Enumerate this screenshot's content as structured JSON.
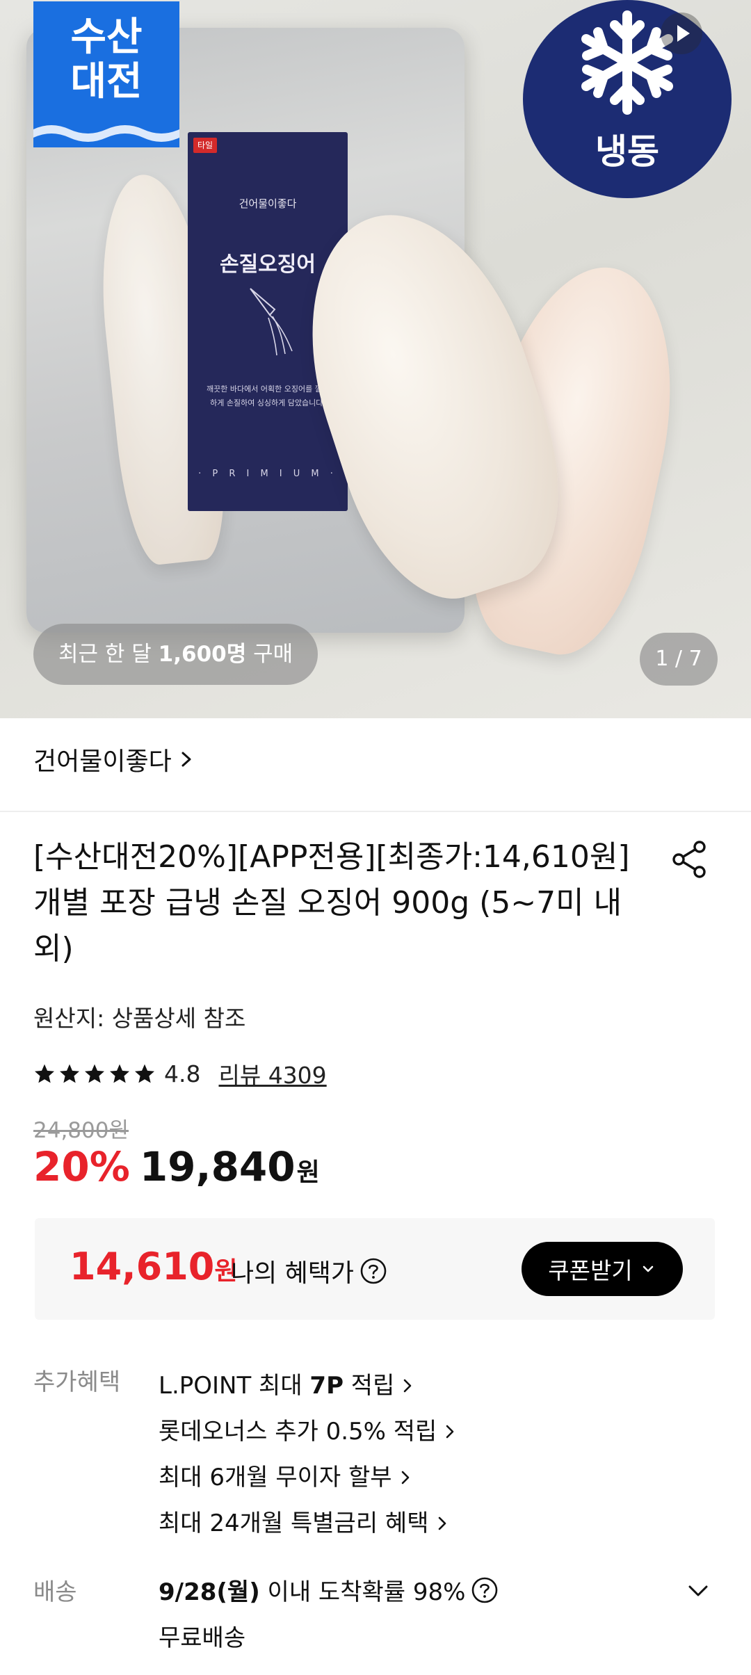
{
  "hero": {
    "sale_badge": {
      "line1": "수산",
      "line2": "대전"
    },
    "frozen_badge": "냉동",
    "package": {
      "tag": "타일",
      "brand": "건어물이좋다",
      "name": "손질오징어",
      "desc": "깨끗한 바다에서 어획한 오징어를 깔끔하게 손질하여 싱싱하게 담았습니다.",
      "premium": "· P R I M I U M ·"
    },
    "buyers_chip": {
      "prefix": "최근 한 달 ",
      "count": "1,600명",
      "suffix": " 구매"
    },
    "page_indicator": "1 / 7"
  },
  "seller": {
    "name": "건어물이좋다"
  },
  "product": {
    "title": "[수산대전20%][APP전용][최종가:14,610원]개별 포장 급냉 손질 오징어 900g (5~7미 내외)",
    "origin": "원산지: 상품상세 참조",
    "rating": {
      "score": "4.8",
      "review_label": "리뷰 4309",
      "stars": 5
    },
    "price": {
      "original": "24,800원",
      "discount": "20%",
      "amount": "19,840",
      "unit": "원"
    }
  },
  "benefit": {
    "amount": "14,610",
    "unit": "원",
    "label": "나의 혜택가",
    "coupon_button": "쿠폰받기"
  },
  "extra_benefits": {
    "heading": "추가혜택",
    "items": [
      {
        "pre": "L.POINT 최대 ",
        "bold": "7P",
        "post": " 적립"
      },
      {
        "pre": "롯데오너스 추가 0.5% 적립",
        "bold": "",
        "post": ""
      },
      {
        "pre": "최대 6개월 무이자 할부",
        "bold": "",
        "post": ""
      },
      {
        "pre": "최대 24개월 특별금리 혜택",
        "bold": "",
        "post": ""
      }
    ]
  },
  "shipping": {
    "heading": "배송",
    "date": "9/28(월)",
    "rate_text": " 이내 도착확률 98%",
    "fee": "무료배송"
  },
  "colors": {
    "accent_red": "#e8232b",
    "sale_blue": "#1a6fe0",
    "frozen_navy": "#1c2c73",
    "button_black": "#000000"
  },
  "icons": [
    "play-icon",
    "chevron-right-icon",
    "share-icon",
    "star-icon",
    "help-circle-icon",
    "chevron-down-icon"
  ]
}
